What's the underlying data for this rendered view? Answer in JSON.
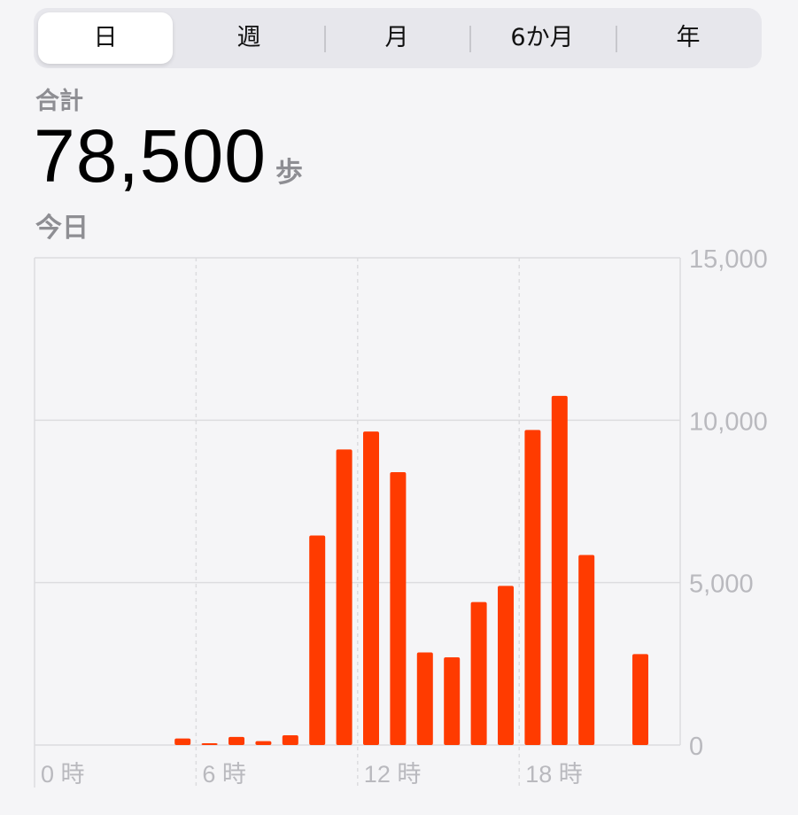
{
  "segments": {
    "items": [
      "日",
      "週",
      "月",
      "6か月",
      "年"
    ],
    "selected": 0
  },
  "summary": {
    "label": "合計",
    "value": "78,500",
    "unit": "歩",
    "period": "今日"
  },
  "colors": {
    "bar": "#ff3b00",
    "grid": "#dcdcdf",
    "tick": "#b9b9be"
  },
  "chart_data": {
    "type": "bar",
    "title": "",
    "xlabel": "",
    "ylabel": "",
    "ylim": [
      0,
      15000
    ],
    "y_ticks": [
      0,
      5000,
      10000,
      15000
    ],
    "y_tick_labels": [
      "0",
      "5,000",
      "10,000",
      "15,000"
    ],
    "x_tick_hours": [
      0,
      6,
      12,
      18
    ],
    "x_tick_labels": [
      "0 時",
      "6 時",
      "12 時",
      "18 時"
    ],
    "categories": [
      0,
      1,
      2,
      3,
      4,
      5,
      6,
      7,
      8,
      9,
      10,
      11,
      12,
      13,
      14,
      15,
      16,
      17,
      18,
      19,
      20,
      21,
      22,
      23
    ],
    "values": [
      0,
      0,
      0,
      0,
      0,
      200,
      30,
      250,
      120,
      300,
      6450,
      9100,
      9650,
      8400,
      2850,
      2700,
      4400,
      4900,
      9700,
      10750,
      5850,
      0,
      2800,
      0
    ]
  }
}
